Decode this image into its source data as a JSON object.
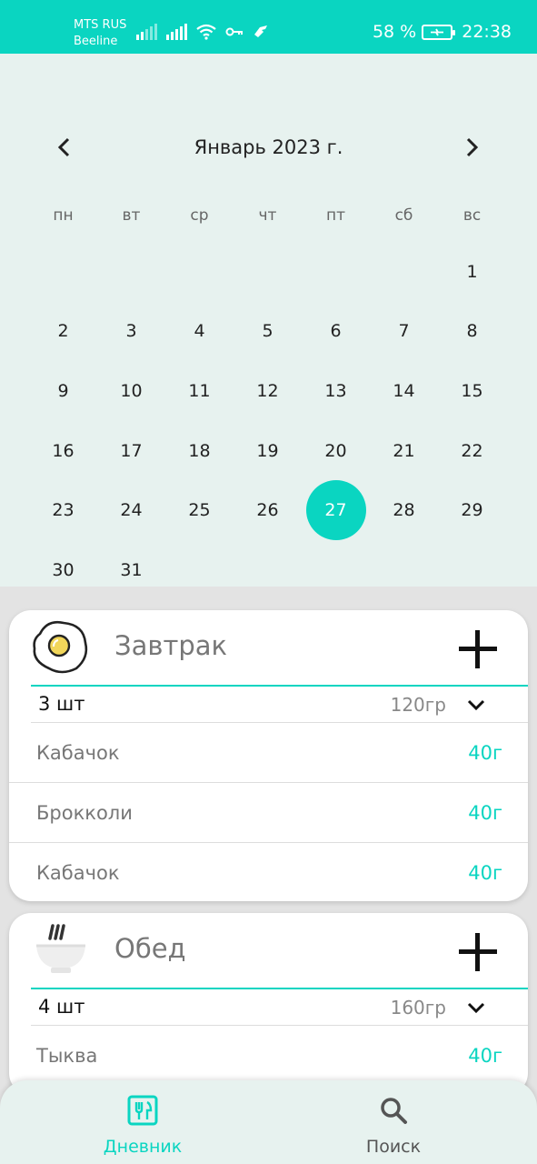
{
  "status_bar": {
    "carrier_1": "MTS RUS",
    "carrier_2": "Beeline",
    "battery": "58 %",
    "time": "22:38"
  },
  "calendar": {
    "title": "Январь 2023 г.",
    "weekdays": [
      "пн",
      "вт",
      "ср",
      "чт",
      "пт",
      "сб",
      "вс"
    ],
    "leading_blank_days": 6,
    "days": [
      "1",
      "2",
      "3",
      "4",
      "5",
      "6",
      "7",
      "8",
      "9",
      "10",
      "11",
      "12",
      "13",
      "14",
      "15",
      "16",
      "17",
      "18",
      "19",
      "20",
      "21",
      "22",
      "23",
      "24",
      "25",
      "26",
      "27",
      "28",
      "29",
      "30",
      "31"
    ],
    "selected_day": "27",
    "accent_color": "#0ad5c1"
  },
  "meals": [
    {
      "title": "Завтрак",
      "icon": "fried-egg-icon",
      "count": "3 шт",
      "weight": "120гр",
      "items": [
        {
          "name": "Кабачок",
          "amount": "40г"
        },
        {
          "name": "Брокколи",
          "amount": "40г"
        },
        {
          "name": "Кабачок",
          "amount": "40г"
        }
      ]
    },
    {
      "title": "Обед",
      "icon": "soup-bowl-icon",
      "count": "4 шт",
      "weight": "160гр",
      "items": [
        {
          "name": "Тыква",
          "amount": "40г"
        }
      ]
    }
  ],
  "bottom_nav": {
    "diary_label": "Дневник",
    "search_label": "Поиск"
  }
}
